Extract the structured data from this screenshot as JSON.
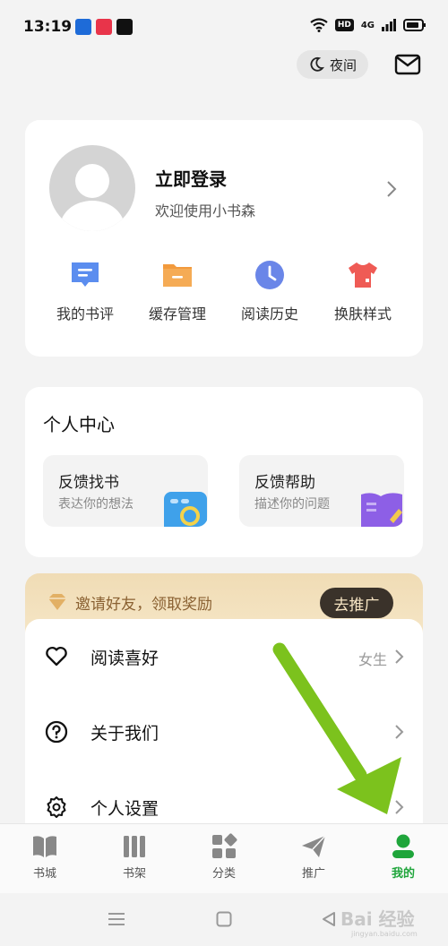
{
  "status": {
    "time": "13:19",
    "hd": "HD",
    "net": "4G",
    "app_badge_colors": [
      "#1e6bd8",
      "#e8344a",
      "#111111"
    ]
  },
  "top": {
    "night_label": "夜间",
    "mail_icon": "mail-icon"
  },
  "profile": {
    "login_title": "立即登录",
    "login_subtitle": "欢迎使用小书森"
  },
  "quick_actions": [
    {
      "label": "我的书评",
      "icon": "comment-icon",
      "color": "#5b8def"
    },
    {
      "label": "缓存管理",
      "icon": "folder-icon",
      "color": "#f29a3d"
    },
    {
      "label": "阅读历史",
      "icon": "clock-icon",
      "color": "#6a86e8"
    },
    {
      "label": "换肤样式",
      "icon": "shirt-icon",
      "color": "#ef5b55"
    }
  ],
  "personal_center": {
    "title": "个人中心",
    "cards": [
      {
        "title": "反馈找书",
        "desc": "表达你的想法",
        "icon": "search-book-icon"
      },
      {
        "title": "反馈帮助",
        "desc": "描述你的问题",
        "icon": "help-book-icon"
      }
    ]
  },
  "invite": {
    "text": "邀请好友，领取奖励",
    "button": "去推广"
  },
  "menu": [
    {
      "label": "阅读喜好",
      "value": "女生",
      "icon": "heart-icon"
    },
    {
      "label": "关于我们",
      "value": "",
      "icon": "question-icon"
    },
    {
      "label": "个人设置",
      "value": "",
      "icon": "gear-icon"
    }
  ],
  "bottom_nav": [
    {
      "label": "书城",
      "icon": "book-icon",
      "active": false
    },
    {
      "label": "书架",
      "icon": "shelf-icon",
      "active": false
    },
    {
      "label": "分类",
      "icon": "category-icon",
      "active": false
    },
    {
      "label": "推广",
      "icon": "send-icon",
      "active": false
    },
    {
      "label": "我的",
      "icon": "user-icon",
      "active": true
    }
  ],
  "colors": {
    "accent_green": "#1fa53b",
    "annotation_arrow": "#7cc21d"
  },
  "watermark": {
    "text": "Bai 经验",
    "url": "jingyan.baidu.com"
  }
}
